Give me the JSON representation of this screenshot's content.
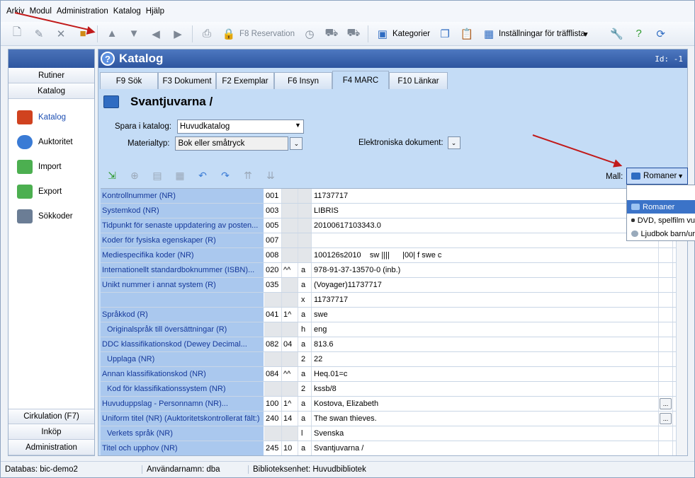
{
  "menu": [
    "Arkiv",
    "Modul",
    "Administration",
    "Katalog",
    "Hjälp"
  ],
  "toolbar": {
    "reservation_label": "F8 Reservation",
    "kategorier_label": "Kategorier",
    "installningar_label": "Inställningar för träfflista"
  },
  "nav": {
    "top_buttons": [
      "Rutiner",
      "Katalog"
    ],
    "items": [
      {
        "label": "Katalog",
        "icon": "book-icon",
        "color": "#d0421f"
      },
      {
        "label": "Auktoritet",
        "icon": "database-icon",
        "color": "#3a7bd5"
      },
      {
        "label": "Import",
        "icon": "import-icon",
        "color": "#4caf50"
      },
      {
        "label": "Export",
        "icon": "export-icon",
        "color": "#4caf50"
      },
      {
        "label": "Sökkoder",
        "icon": "abc-search-icon",
        "color": "#6b7d95"
      }
    ],
    "bottom_buttons": [
      "Cirkulation (F7)",
      "Inköp",
      "Administration"
    ]
  },
  "panel": {
    "title": "Katalog",
    "id_label": "Id: -1",
    "tabs": [
      "F9 Sök",
      "F3 Dokument",
      "F2 Exemplar",
      "F6 Insyn",
      "F4 MARC",
      "F10 Länkar"
    ],
    "active_tab": "F4 MARC",
    "record_title": "Svantjuvarna /",
    "spara_label": "Spara i katalog:",
    "spara_value": "Huvudkatalog",
    "materialtyp_label": "Materialtyp:",
    "materialtyp_value": "Bok eller småtryck",
    "elektroniska_label": "Elektroniska dokument:",
    "mall_label": "Mall:",
    "mall_value": "Romaner"
  },
  "mall_options": [
    {
      "label": "Romaner",
      "selected": true
    },
    {
      "label": "DVD, spelfilm vu",
      "selected": false
    },
    {
      "label": "Ljudbok barn/ur",
      "selected": false
    }
  ],
  "marc_rows": [
    {
      "name": "Kontrollnummer (NR)",
      "tag": "001",
      "ind": "",
      "sub": "",
      "value": "11737717",
      "indent": false,
      "btn": false
    },
    {
      "name": "Systemkod (NR)",
      "tag": "003",
      "ind": "",
      "sub": "",
      "value": "LIBRIS",
      "indent": false,
      "btn": false
    },
    {
      "name": "Tidpunkt för senaste uppdatering av posten...",
      "tag": "005",
      "ind": "",
      "sub": "",
      "value": "20100617103343.0",
      "indent": false,
      "btn": false
    },
    {
      "name": "Koder för fysiska egenskaper (R)",
      "tag": "007",
      "ind": "",
      "sub": "",
      "value": "",
      "indent": false,
      "btn": false
    },
    {
      "name": "Mediespecifika koder (NR)",
      "tag": "008",
      "ind": "",
      "sub": "",
      "value": "100126s2010    sw ||||      |00| f swe c",
      "indent": false,
      "btn": false
    },
    {
      "name": "Internationellt standardboknummer (ISBN)...",
      "tag": "020",
      "ind": "^^",
      "sub": "a",
      "value": "978-91-37-13570-0 (inb.)",
      "indent": false,
      "btn": false
    },
    {
      "name": "Unikt nummer i annat system (R)",
      "tag": "035",
      "ind": "",
      "sub": "a",
      "value": "(Voyager)11737717",
      "indent": false,
      "btn": false
    },
    {
      "name": "",
      "tag": "",
      "ind": "",
      "sub": "x",
      "value": "11737717",
      "indent": false,
      "btn": false
    },
    {
      "name": "Språkkod (R)",
      "tag": "041",
      "ind": "1^",
      "sub": "a",
      "value": "swe",
      "indent": false,
      "btn": false
    },
    {
      "name": "Originalspråk till översättningar (R)",
      "tag": "",
      "ind": "",
      "sub": "h",
      "value": "eng",
      "indent": true,
      "btn": false
    },
    {
      "name": "DDC klassifikationskod (Dewey Decimal...",
      "tag": "082",
      "ind": "04",
      "sub": "a",
      "value": "813.6",
      "indent": false,
      "btn": false
    },
    {
      "name": "Upplaga (NR)",
      "tag": "",
      "ind": "",
      "sub": "2",
      "value": "22",
      "indent": true,
      "btn": false
    },
    {
      "name": "Annan klassifikationskod (NR)",
      "tag": "084",
      "ind": "^^",
      "sub": "a",
      "value": "Heq.01=c",
      "indent": false,
      "btn": false
    },
    {
      "name": "Kod för klassifikationssystem (NR)",
      "tag": "",
      "ind": "",
      "sub": "2",
      "value": "kssb/8",
      "indent": true,
      "btn": false
    },
    {
      "name": "Huvuduppslag - Personnamn (NR)...",
      "tag": "100",
      "ind": "1^",
      "sub": "a",
      "value": "Kostova, Elizabeth",
      "indent": false,
      "btn": true
    },
    {
      "name": "Uniform titel (NR) (Auktoritetskontrollerat fält:)",
      "tag": "240",
      "ind": "14",
      "sub": "a",
      "value": "The swan thieves.",
      "indent": false,
      "btn": true
    },
    {
      "name": "Verkets språk (NR)",
      "tag": "",
      "ind": "",
      "sub": "l",
      "value": "Svenska",
      "indent": true,
      "btn": false
    },
    {
      "name": "Titel och upphov (NR)",
      "tag": "245",
      "ind": "10",
      "sub": "a",
      "value": "Svantjuvarna /",
      "indent": false,
      "btn": false
    }
  ],
  "status": {
    "databas": "Databas: bic-demo2",
    "anvandare": "Användarnamn: dba",
    "enhet": "Biblioteksenhet: Huvudbibliotek"
  },
  "colors": {
    "accent": "#2d559f",
    "annotation_arrow": "#c11a1a",
    "field_name_bg": "#aac8ee"
  }
}
